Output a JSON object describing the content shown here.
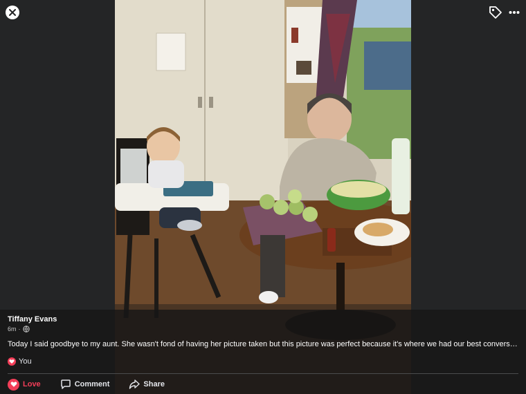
{
  "post": {
    "author": "Tiffany Evans",
    "time": "6m",
    "separator": "·",
    "privacy_icon": "globe-icon",
    "caption": "Today I said goodbye to my aunt. She wasn't fond of having her picture taken but this picture was perfect because it's where we had our best conversati..."
  },
  "reactions": {
    "icon": "heart-icon",
    "label": "You"
  },
  "actions": {
    "love": "Love",
    "comment": "Comment",
    "share": "Share"
  },
  "top_controls": {
    "close": "close-icon",
    "tag": "tag-icon",
    "more": "more-icon"
  },
  "colors": {
    "love_red": "#f33e58",
    "background": "#242526"
  }
}
